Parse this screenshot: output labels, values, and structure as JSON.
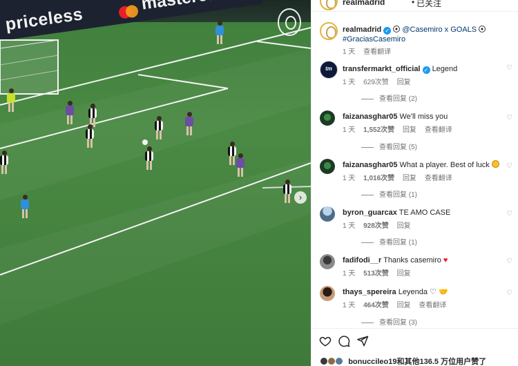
{
  "media": {
    "board_left_text": "priceless",
    "board_right_text": "mastercard",
    "next_glyph": "›"
  },
  "header": {
    "username": "realmadrid",
    "separator": "•",
    "follow_label": "已关注"
  },
  "caption": {
    "username": "realmadrid",
    "text_mention": "@Casemiro x GOALS",
    "hashtag": "#GraciasCasemiro",
    "age": "1 天",
    "translate": "查看翻译"
  },
  "comments": [
    {
      "username": "transfermarkt_official",
      "verified": true,
      "text": "Legend",
      "age": "1 天",
      "likes": "629次赞",
      "reply": "回复",
      "replies": "查看回复 (2)"
    },
    {
      "username": "faizanasghar05",
      "text": "We'll miss you",
      "age": "1 天",
      "likes": "1,552次赞",
      "reply": "回复",
      "translate": "查看翻译",
      "replies": "查看回复 (5)"
    },
    {
      "username": "faizanasghar05",
      "text": "What a player. Best of luck",
      "age": "1 天",
      "likes": "1,016次赞",
      "reply": "回复",
      "translate": "查看翻译",
      "replies": "查看回复 (1)"
    },
    {
      "username": "byron_guarcax",
      "text": "TE AMO CASE",
      "age": "1 天",
      "likes": "928次赞",
      "reply": "回复",
      "replies": "查看回复 (1)"
    },
    {
      "username": "fadifodi__r",
      "text": "Thanks casemiro",
      "age": "1 天",
      "likes": "513次赞",
      "reply": "回复"
    },
    {
      "username": "thays_spereira",
      "text": "Leyenda",
      "age": "1 天",
      "likes": "464次赞",
      "reply": "回复",
      "translate": "查看翻译",
      "replies": "查看回复 (3)"
    }
  ],
  "actions": {
    "like_icon": "heart-icon",
    "comment_icon": "comment-icon",
    "share_icon": "send-icon"
  },
  "likes_summary": {
    "user": "bonuccileo19",
    "rest": "和其他136.5 万位用户赞了"
  },
  "colors": {
    "link": "#00376b",
    "verified": "#1d9bf0",
    "muted": "#737373"
  }
}
